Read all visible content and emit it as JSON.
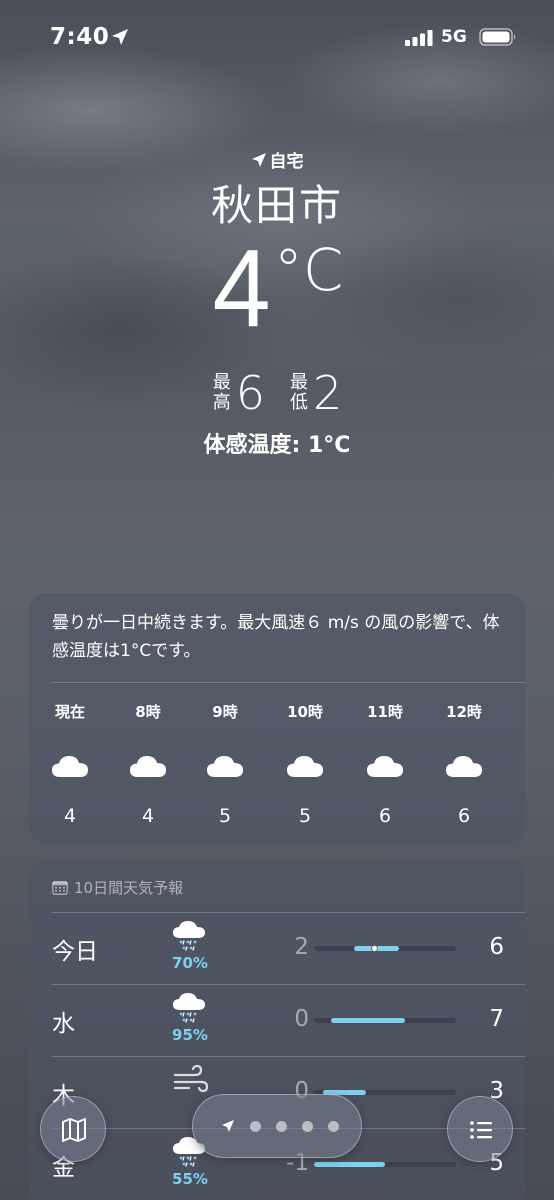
{
  "status": {
    "time": "7:40",
    "network": "5G"
  },
  "location": {
    "label": "自宅",
    "city": "秋田市"
  },
  "current": {
    "temp": "4",
    "unit": "°C",
    "high_label": "最高",
    "high": "6",
    "low_label": "最低",
    "low": "2",
    "feels_like": "体感温度: 1°C"
  },
  "hourly": {
    "summary": "曇りが一日中続きます。最大風速６ m/s の風の影響で、体感温度は1°Cです。",
    "hours": [
      {
        "time": "現在",
        "icon": "cloud-icon",
        "temp": "4"
      },
      {
        "time": "8時",
        "icon": "cloud-icon",
        "temp": "4"
      },
      {
        "time": "9時",
        "icon": "cloud-icon",
        "temp": "5"
      },
      {
        "time": "10時",
        "icon": "cloud-icon",
        "temp": "5"
      },
      {
        "time": "11時",
        "icon": "cloud-icon",
        "temp": "6"
      },
      {
        "time": "12時",
        "icon": "cloud-icon",
        "temp": "6"
      }
    ]
  },
  "daily": {
    "header": "10日間天気予報",
    "days": [
      {
        "day": "今日",
        "icon": "sleet-cloud-icon",
        "precip": "70%",
        "low": "2",
        "high": "6",
        "bar_start": 0.28,
        "bar_end": 0.6,
        "current_marker": 0.42
      },
      {
        "day": "水",
        "icon": "sleet-cloud-icon",
        "precip": "95%",
        "low": "0",
        "high": "7",
        "bar_start": 0.12,
        "bar_end": 0.64
      },
      {
        "day": "木",
        "icon": "wind-icon",
        "precip": "",
        "low": "0",
        "high": "3",
        "bar_start": 0.06,
        "bar_end": 0.36
      },
      {
        "day": "金",
        "icon": "sleet-cloud-icon",
        "precip": "55%",
        "low": "-1",
        "high": "5",
        "bar_start": 0.0,
        "bar_end": 0.5
      }
    ]
  },
  "colors": {
    "accent": "#7fcff2"
  }
}
